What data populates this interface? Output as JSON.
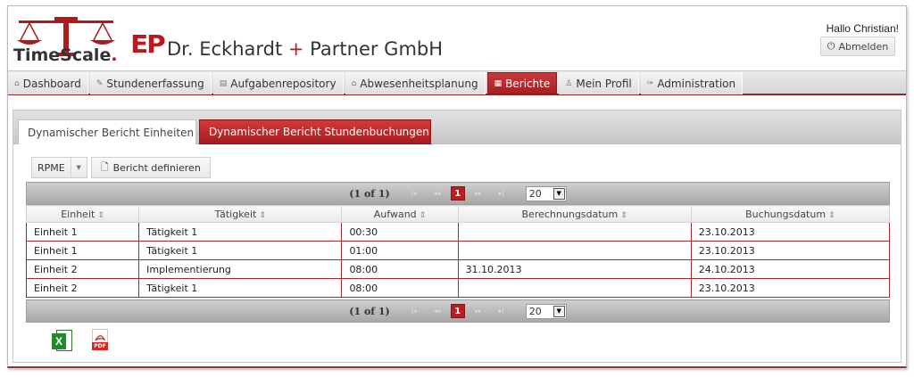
{
  "header": {
    "brand_prefix": "TimeScale",
    "brand_dot": ".",
    "ep_logo": "EP",
    "company_pre": "Dr. Eckhardt ",
    "company_plus": "+",
    "company_post": " Partner GmbH",
    "greeting": "Hallo Christian!",
    "logout_label": "Abmelden",
    "colors": {
      "accent": "#c0171e",
      "nav_active": "#b0292b"
    }
  },
  "nav": {
    "items": [
      {
        "label": "Dashboard",
        "icon": "home-icon",
        "glyph": "⌂"
      },
      {
        "label": "Stundenerfassung",
        "icon": "pencil-icon",
        "glyph": "✎"
      },
      {
        "label": "Aufgabenrepository",
        "icon": "folder-icon",
        "glyph": "▤"
      },
      {
        "label": "Abwesenheitsplanung",
        "icon": "building-icon",
        "glyph": "⌂"
      },
      {
        "label": "Berichte",
        "icon": "grid-icon",
        "glyph": "▦",
        "active": true
      },
      {
        "label": "Mein Profil",
        "icon": "person-icon",
        "glyph": "♙"
      },
      {
        "label": "Administration",
        "icon": "wrench-icon",
        "glyph": "✑"
      }
    ]
  },
  "tabs": {
    "tab1": "Dynamischer Bericht Einheiten",
    "tab2": "Dynamischer Bericht Stundenbuchungen"
  },
  "toolbar": {
    "select_value": "RPME",
    "define_label": "Bericht definieren"
  },
  "pager": {
    "count": "(1 of 1)",
    "current_page": "1",
    "rows_per_page": "20"
  },
  "table": {
    "columns": [
      "Einheit",
      "Tätigkeit",
      "Aufwand",
      "Berechnungsdatum",
      "Buchungsdatum"
    ],
    "rows": [
      [
        "Einheit 1",
        "Tätigkeit 1",
        "00:30",
        "",
        "23.10.2013"
      ],
      [
        "Einheit 1",
        "Tätigkeit 1",
        "01:00",
        "",
        "23.10.2013"
      ],
      [
        "Einheit 2",
        "Implementierung",
        "08:00",
        "31.10.2013",
        "24.10.2013"
      ],
      [
        "Einheit 2",
        "Tätigkeit 1",
        "08:00",
        "",
        "23.10.2013"
      ]
    ]
  },
  "export": {
    "excel_icon": "excel-icon",
    "pdf_icon": "pdf-icon",
    "pdf_band": "PDF"
  }
}
